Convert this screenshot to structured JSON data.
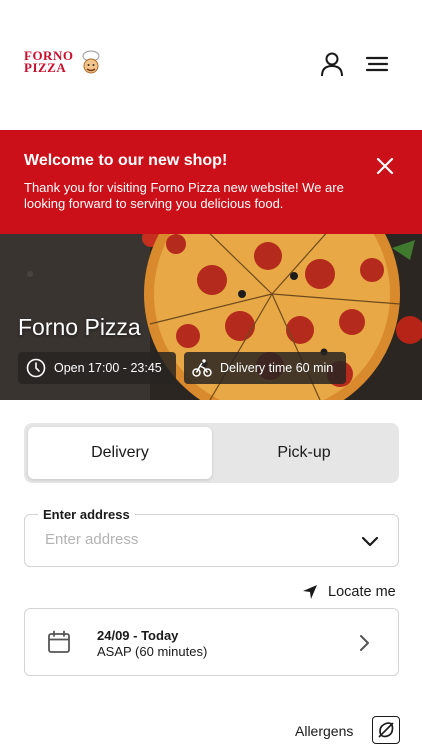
{
  "header": {
    "logo_line1": "FORNO",
    "logo_line2": "PIZZA"
  },
  "banner": {
    "title": "Welcome to our new shop!",
    "message": "Thank you for visiting Forno Pizza new website! We are looking forward to serving you delicious food."
  },
  "hero": {
    "title": "Forno Pizza",
    "open_hours": "Open 17:00 - 23:45",
    "delivery_time": "Delivery time 60 min"
  },
  "order_mode": {
    "delivery": "Delivery",
    "pickup": "Pick-up"
  },
  "address": {
    "label": "Enter address",
    "placeholder": "Enter address",
    "value": ""
  },
  "locate": {
    "label": "Locate me"
  },
  "schedule": {
    "date": "24/09 - Today",
    "time": "ASAP (60 minutes)"
  },
  "allergens": {
    "label": "Allergens"
  },
  "colors": {
    "brand_red": "#cc1019"
  },
  "icons": [
    "user-icon",
    "menu-icon",
    "close-icon",
    "clock-icon",
    "bike-icon",
    "chevron-down-icon",
    "location-arrow-icon",
    "calendar-icon",
    "chevron-right-icon",
    "allergen-icon"
  ]
}
